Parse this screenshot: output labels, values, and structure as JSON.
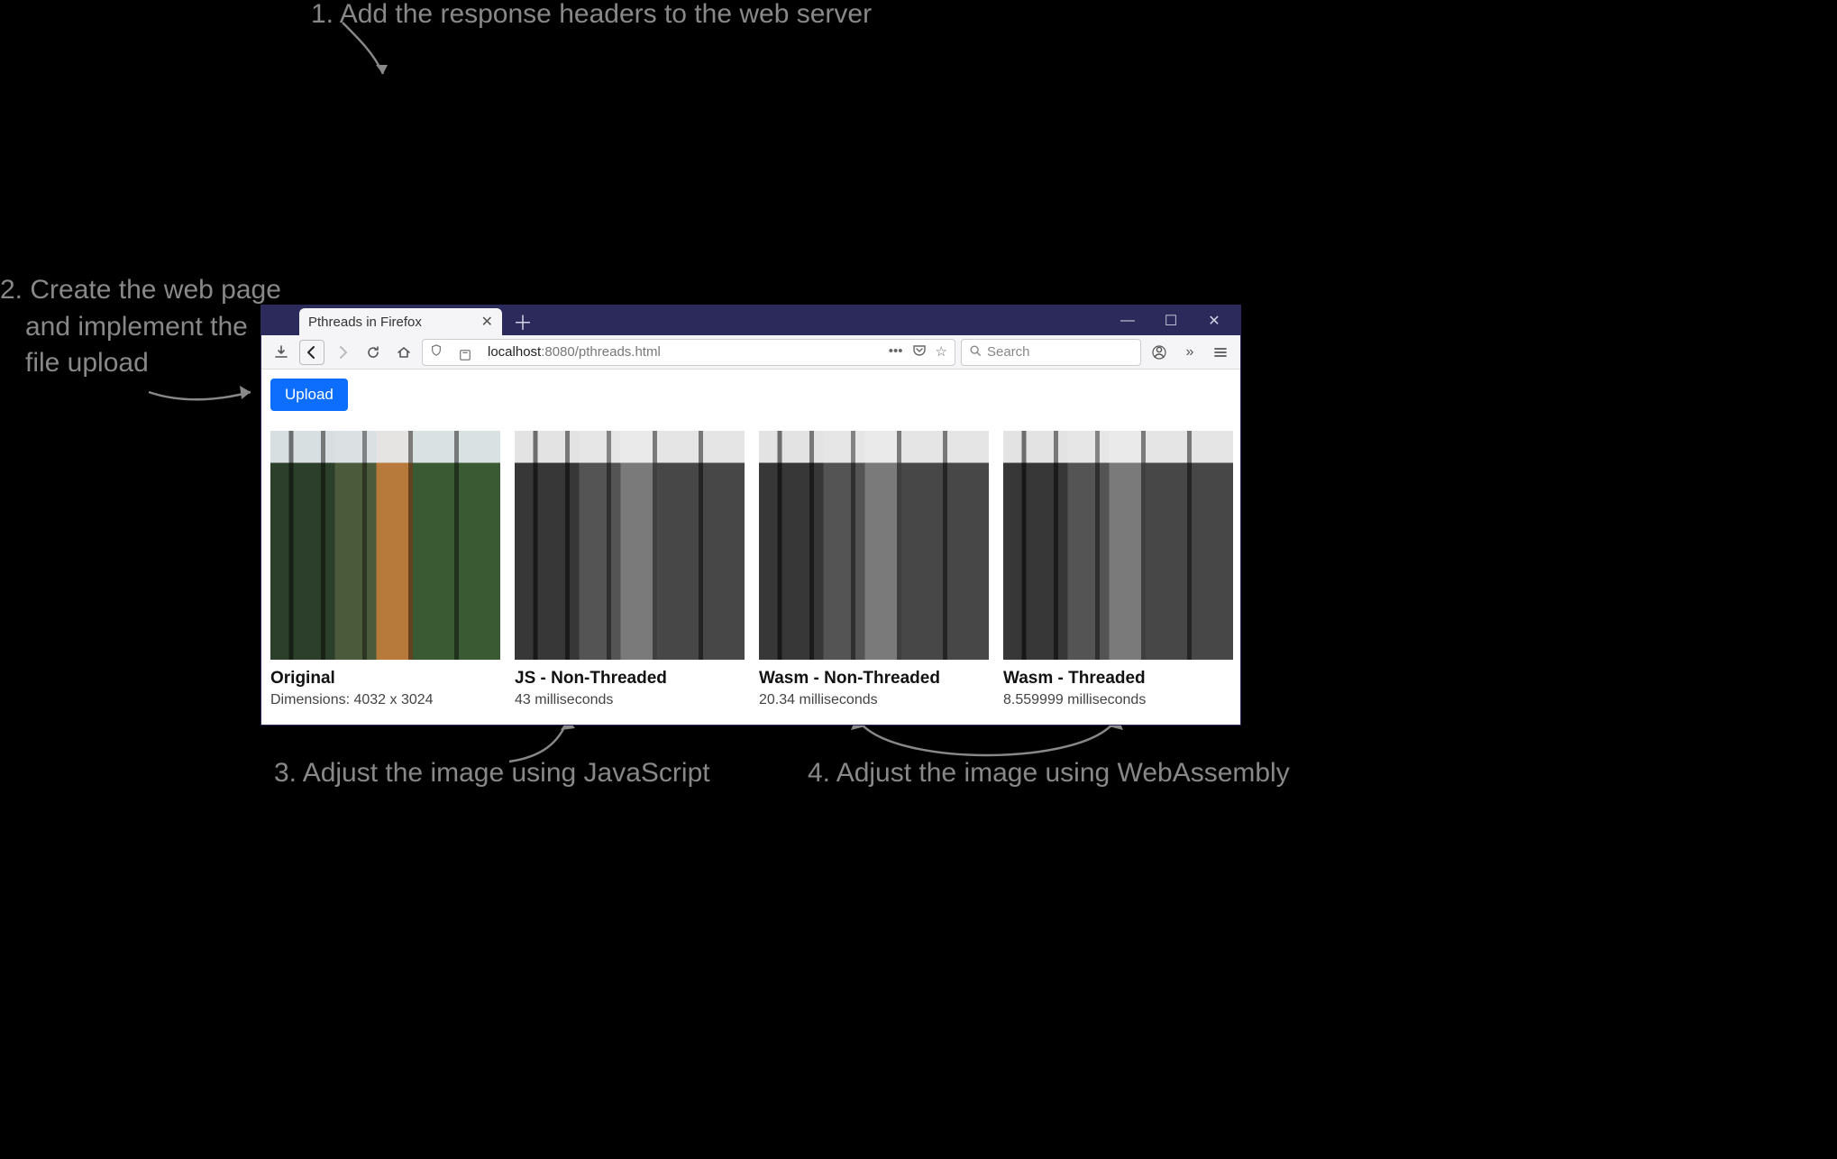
{
  "annotations": {
    "step1": "1. Add the response headers to the web server",
    "step2_line1": "2. Create the web page",
    "step2_line2": "and implement the",
    "step2_line3": "file upload",
    "step3": "3. Adjust the image using JavaScript",
    "step4": "4. Adjust the image using WebAssembly"
  },
  "browser": {
    "tab_title": "Pthreads in Firefox",
    "url_host": "localhost",
    "url_port": ":8080",
    "url_path": "/pthreads.html",
    "search_placeholder": "Search"
  },
  "page": {
    "upload_label": "Upload",
    "cards": [
      {
        "title": "Original",
        "sub": "Dimensions: 4032 x 3024",
        "gray": false
      },
      {
        "title": "JS - Non-Threaded",
        "sub": "43 milliseconds",
        "gray": true
      },
      {
        "title": "Wasm - Non-Threaded",
        "sub": "20.34 milliseconds",
        "gray": true
      },
      {
        "title": "Wasm - Threaded",
        "sub": "8.559999 milliseconds",
        "gray": true
      }
    ]
  }
}
